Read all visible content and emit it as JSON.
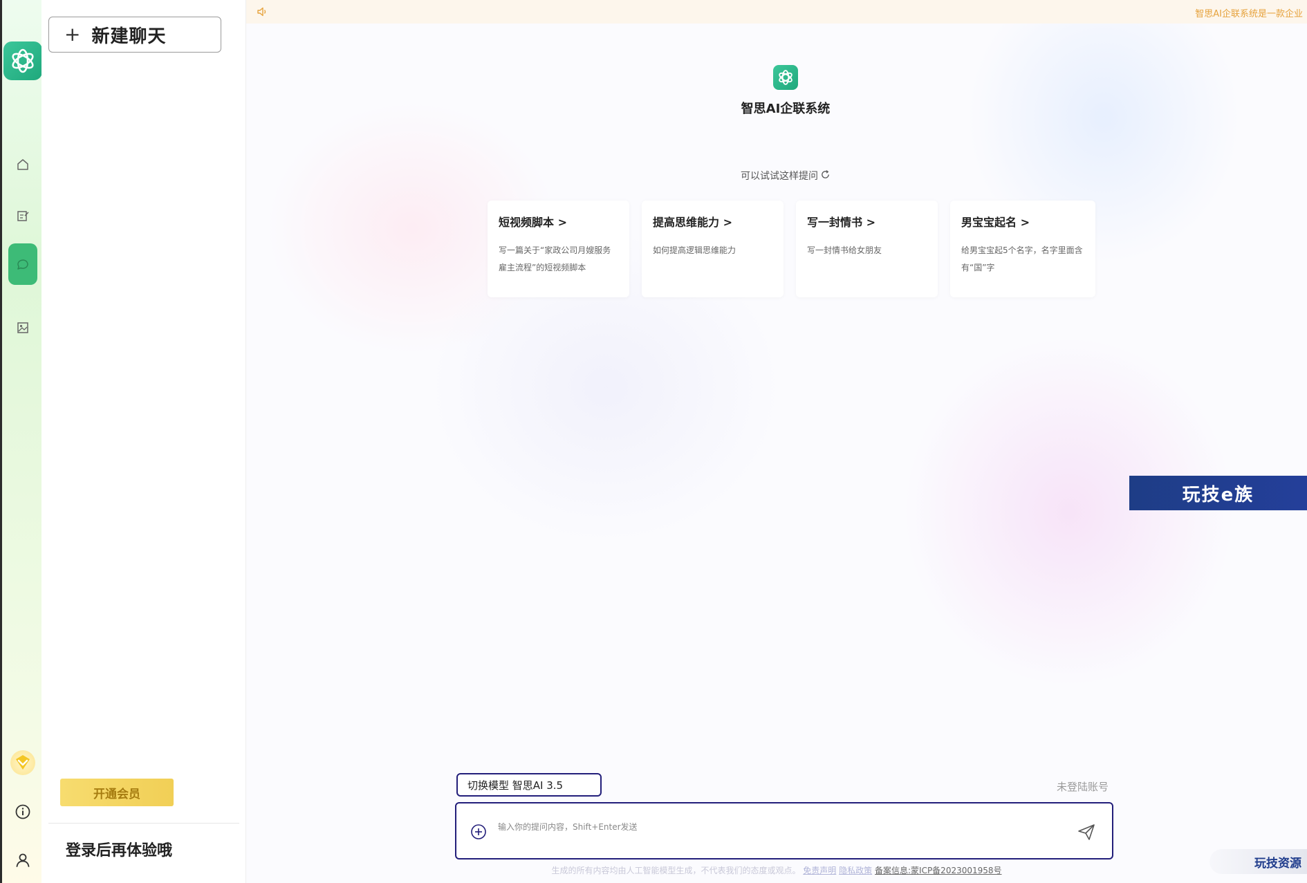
{
  "rail": {
    "icons": [
      "openai-logo-icon",
      "home-icon",
      "edit-icon",
      "chat-icon",
      "image-edit-icon",
      "vip-icon",
      "info-icon",
      "user-icon"
    ]
  },
  "sidebar": {
    "new_chat_plus": "+",
    "new_chat_label": "新建聊天",
    "member_button": "开通会员",
    "login_hint": "登录后再体验哦"
  },
  "notice": {
    "text": "智思AI企联系统是一款企业"
  },
  "brand": {
    "name": "智思AI企联系统"
  },
  "suggestions": {
    "title": "可以试试这样提问",
    "cards": [
      {
        "title": "短视频脚本",
        "desc": "写一篇关于“家政公司月嫂服务雇主流程”的短视频脚本"
      },
      {
        "title": "提高思维能力",
        "desc": "如何提高逻辑思维能力"
      },
      {
        "title": "写一封情书",
        "desc": "写一封情书给女朋友"
      },
      {
        "title": "男宝宝起名",
        "desc": "给男宝宝起5个名字，名字里面含有“国”字"
      }
    ]
  },
  "composer": {
    "model_button": "切换模型 智思AI 3.5",
    "account_status": "未登陆账号",
    "placeholder": "输入你的提问内容，Shift+Enter发送"
  },
  "footer": {
    "disclaimer": "生成的所有内容均由人工智能模型生成，不代表我们的态度或观点。",
    "link_disclaimer": "免责声明",
    "link_privacy": "隐私政策",
    "icp": "备案信息:蒙ICP备2023001958号"
  },
  "watermarks": {
    "banner": "玩技e族",
    "badge": "玩技资源"
  },
  "colors": {
    "accent_green": "#3dbb77",
    "input_border": "#221e7a",
    "notice_text": "#e6a23c",
    "member_gold": "#f1cf56"
  }
}
